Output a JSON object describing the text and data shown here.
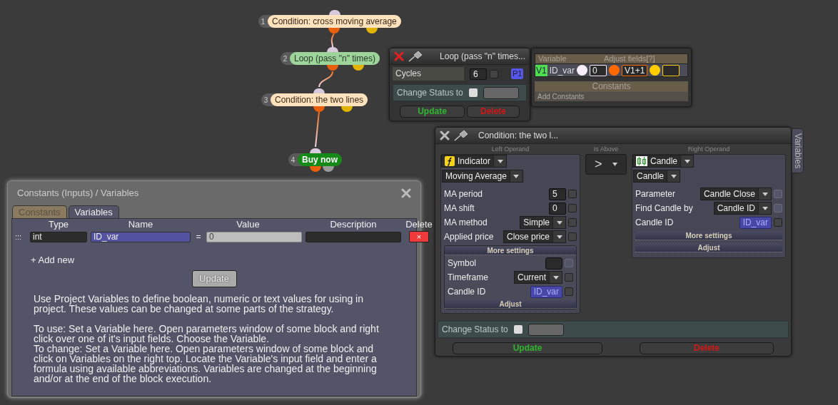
{
  "flow_nodes": [
    {
      "number": "1",
      "label": "Condition: cross moving average",
      "kind": "condition"
    },
    {
      "number": "2",
      "label": "Loop (pass \"n\" times)",
      "kind": "loop"
    },
    {
      "number": "3",
      "label": "Condition: the two lines",
      "kind": "condition"
    },
    {
      "number": "4",
      "label": "Buy now",
      "kind": "action"
    }
  ],
  "loop_window": {
    "title": "Loop (pass \"n\" times...",
    "cycles_label": "Cycles",
    "cycles_value": "6",
    "cycles_checked": false,
    "badge": "P1",
    "change_status_label": "Change Status to",
    "change_status_checked": false,
    "update": "Update",
    "delete": "Delete"
  },
  "variables_panel": {
    "variable_header": "Variable",
    "adjust_header": "Adjust fields[?]",
    "variables": [
      {
        "badge": "V1",
        "name": "ID_var",
        "fields": [
          {
            "color": "#f8eefa",
            "value": "0"
          },
          {
            "color": "#ff6a00",
            "value": "V1+1"
          },
          {
            "color": "#ffcc00"
          }
        ]
      }
    ],
    "constants_header": "Constants",
    "add_constants": "Add Constants"
  },
  "condition_window": {
    "title": "Condition: the two l...",
    "left_label": "Left Operand",
    "operator_label": "Is Above",
    "right_label": "Right Operand",
    "operator": ">",
    "left": {
      "kind": "indicator",
      "type": "Indicator",
      "subtype": "Moving Average",
      "params": [
        {
          "kind": "number",
          "label": "MA period",
          "value": "5",
          "checked": false,
          "disabled": false
        },
        {
          "kind": "number",
          "label": "MA shift",
          "value": "0",
          "checked": false,
          "disabled": false
        },
        {
          "kind": "dropdown",
          "label": "MA method",
          "value": "Simple",
          "checked": false,
          "disabled": false
        },
        {
          "kind": "dropdown",
          "label": "Applied price",
          "value": "Close price",
          "checked": false,
          "disabled": false
        }
      ],
      "more_settings": "More settings",
      "more_params": [
        {
          "kind": "box",
          "label": "Symbol",
          "checked": false,
          "disabled": true
        },
        {
          "kind": "dropdown",
          "label": "Timeframe",
          "value": "Current",
          "checked": false,
          "disabled": false
        },
        {
          "kind": "variable",
          "label": "Candle ID",
          "value": "ID_var",
          "checked": false,
          "disabled": false
        }
      ],
      "adjust": "Adjust"
    },
    "right": {
      "kind": "candle",
      "type": "Candle",
      "subtype": "Candle",
      "params": [
        {
          "kind": "dropdown",
          "label": "Parameter",
          "value": "Candle Close",
          "checked": false,
          "disabled": true
        },
        {
          "kind": "dropdown",
          "label": "Find Candle by",
          "value": "Candle ID",
          "checked": false,
          "disabled": true
        },
        {
          "kind": "variable",
          "label": "Candle ID",
          "value": "ID_var",
          "checked": false,
          "disabled": false
        }
      ],
      "more_settings": "More settings",
      "adjust": "Adjust"
    },
    "change_status_label": "Change Status to",
    "change_status_checked": false,
    "update": "Update",
    "delete": "Delete",
    "side_tab": "Variables"
  },
  "constants_window": {
    "title": "Constants (Inputs) / Variables",
    "tabs": [
      {
        "label": "Constants",
        "selected": false
      },
      {
        "label": "Variables",
        "selected": true
      }
    ],
    "columns": [
      "Type",
      "Name",
      "Value",
      "Description",
      "Delete"
    ],
    "rows": [
      {
        "handle": ":::",
        "type": "int",
        "name": "ID_var",
        "equals": "=",
        "value": "0",
        "delete": "×"
      }
    ],
    "add_new": "+ Add new",
    "update": "Update",
    "help": [
      [
        "Use Project Variables to define boolean, numeric or text values for using in project. These values can be changed at some parts of the strategy."
      ],
      [
        "To use: Set a Variable here. Open parameters window of some block and right click over one of it's input fields. Choose the Variable.",
        "To change: Set a Variable here. Open parameters window of some block and click on Variables on the right top. Locate the Variable's input field and enter a formula using available abbreviations. Variables are changed at the beginning and/or at the end of the block execution."
      ]
    ]
  }
}
